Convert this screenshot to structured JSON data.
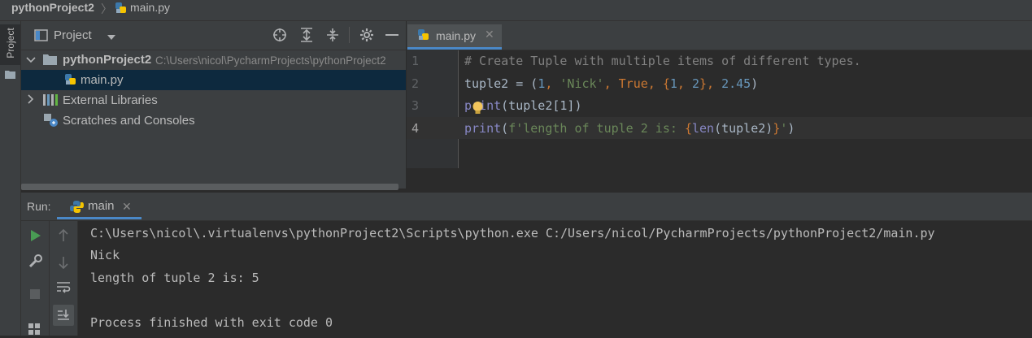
{
  "breadcrumb": {
    "project": "pythonProject2",
    "file": "main.py"
  },
  "left_strip": {
    "project_tab": "Project"
  },
  "project_panel": {
    "title": "Project",
    "tree": {
      "root_name": "pythonProject2",
      "root_path": "C:\\Users\\nicol\\PycharmProjects\\pythonProject2",
      "file": "main.py",
      "external_libraries": "External Libraries",
      "scratches": "Scratches and Consoles"
    }
  },
  "editor": {
    "tab_label": "main.py",
    "line_numbers": [
      "1",
      "2",
      "3",
      "4"
    ],
    "lines": {
      "l1": "# Create Tuple with multiple items of different types.",
      "l2": {
        "a": "tuple2 = (",
        "n1": "1",
        "c1": ", ",
        "s1": "'Nick'",
        "c2": ", ",
        "k1": "True",
        "c3": ", {",
        "n2": "1",
        "c4": ", ",
        "n3": "2",
        "c5": "}, ",
        "n4": "2.45",
        "e": ")"
      },
      "l3": {
        "fn": "print",
        "rest": "(tuple2[1])"
      },
      "l4": {
        "fn": "print",
        "p1": "(",
        "s1": "f'length of tuple 2 is: ",
        "b1": "{",
        "fn2": "len",
        "mid": "(tuple2)",
        "b2": "}",
        "s2": "'",
        "e": ")"
      }
    }
  },
  "run": {
    "label": "Run:",
    "tab": "main",
    "output": [
      "C:\\Users\\nicol\\.virtualenvs\\pythonProject2\\Scripts\\python.exe C:/Users/nicol/PycharmProjects/pythonProject2/main.py",
      "Nick",
      "length of tuple 2 is: 5",
      "",
      "Process finished with exit code 0"
    ]
  },
  "colors": {
    "accent": "#4a88c7",
    "selection": "#0d293e",
    "run_green": "#499c54"
  }
}
